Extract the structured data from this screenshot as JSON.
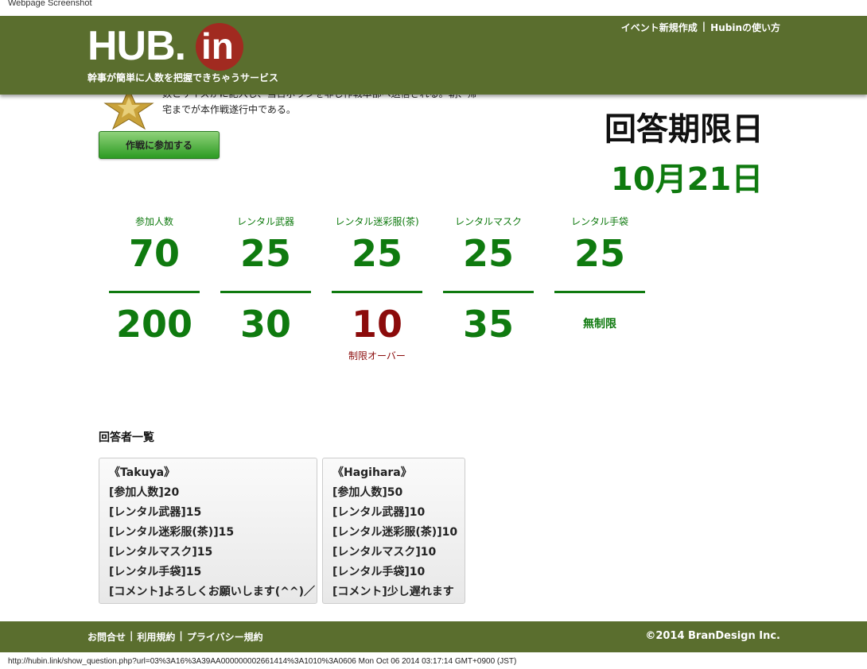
{
  "screenshot_caption": "Webpage Screenshot",
  "header": {
    "logo_text": "HUB.",
    "logo_in": "in",
    "tagline": "幹事が簡単に人数を把握できちゃうサービス",
    "nav": [
      {
        "label": "イベント新規作成"
      },
      {
        "label": "|"
      },
      {
        "label": "Hubinの使い方"
      }
    ]
  },
  "event": {
    "description_line1": "数とサイズがに記入し、当日ボランを非し作戦本部へ送信される。朝、帰",
    "description_line2": "宅までが本作戦遂行中である。",
    "join_button": "作戦に参加する"
  },
  "deadline": {
    "label": "回答期限日",
    "date": "10月21日"
  },
  "stats": [
    {
      "label": "参加人数",
      "current": "70",
      "limit": "200",
      "note": ""
    },
    {
      "label": "レンタル武器",
      "current": "25",
      "limit": "30",
      "note": ""
    },
    {
      "label": "レンタル迷彩服(茶)",
      "current": "25",
      "limit": "10",
      "note": "制限オーバー"
    },
    {
      "label": "レンタルマスク",
      "current": "25",
      "limit": "35",
      "note": ""
    },
    {
      "label": "レンタル手袋",
      "current": "25",
      "limit": "無制限",
      "note": ""
    }
  ],
  "respondents_title": "回答者一覧",
  "respondents": [
    {
      "name": "《Takuya》",
      "lines": [
        "[参加人数]20",
        "[レンタル武器]15",
        "[レンタル迷彩服(茶)]15",
        "[レンタルマスク]15",
        "[レンタル手袋]15",
        "[コメント]よろしくお願いします(^^)／"
      ]
    },
    {
      "name": "《Hagihara》",
      "lines": [
        "[参加人数]50",
        "[レンタル武器]10",
        "[レンタル迷彩服(茶)]10",
        "[レンタルマスク]10",
        "[レンタル手袋]10",
        "[コメント]少し遅れます"
      ]
    }
  ],
  "footer": {
    "links": [
      {
        "label": "お問合せ"
      },
      {
        "label": "|"
      },
      {
        "label": "利用規約"
      },
      {
        "label": "|"
      },
      {
        "label": "プライバシー規約"
      }
    ],
    "copyright": "©2014 BranDesign Inc."
  },
  "status_bar_url": "http://hubin.link/show_question.php?url=03%3A16%3A39AA000000002661414%3A1010%3A0606 Mon Oct 06 2014 03:17:14 GMT+0900 (JST)",
  "colors": {
    "header_bg": "#5a6e2e",
    "accent_green": "#0f7a0f",
    "over_red": "#8b0b0b"
  }
}
